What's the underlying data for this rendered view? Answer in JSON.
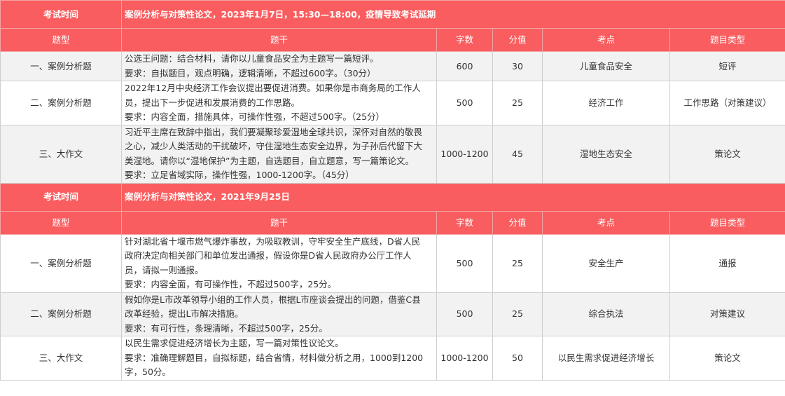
{
  "sections": [
    {
      "header_label": "考试时间",
      "header_value": "案例分析与对策性论文，2023年1月7日，15:30—18:00，疫情导致考试延期",
      "columns": [
        "题型",
        "题干",
        "字数",
        "分值",
        "考点",
        "题目类型"
      ],
      "rows": [
        {
          "type": "一、案例分析题",
          "lines": [
            "公选王问题：结合材料，请你以儿童食品安全为主题写一篇短评。",
            "要求：自拟题目，观点明确，逻辑清晰，不超过600字。（30分）"
          ],
          "words": "600",
          "score": "30",
          "point": "儿童食品安全",
          "category": "短评"
        },
        {
          "type": "二、案例分析题",
          "lines": [
            "2022年12月中央经济工作会议提出要促进消费。如果你是市商务局的工作人",
            "员，提出下一步促进和发展消费的工作思路。",
            "要求：内容全面，措施具体，可操作性强，不超过500字。（25分）"
          ],
          "words": "500",
          "score": "25",
          "point": "经济工作",
          "category": "工作思路（对策建议）"
        },
        {
          "type": "三、大作文",
          "lines": [
            "习近平主席在致辞中指出，我们要凝聚珍爱湿地全球共识，深怀对自然的敬畏",
            "之心，减少人类活动的干扰破坏，守住湿地生态安全边界，为子孙后代留下大",
            "美湿地。请你以“湿地保护”为主题，自选题目，自立题意，写一篇策论文。",
            "要求：立足省域实际，操作性强，1000-1200字。（45分）"
          ],
          "words": "1000-1200",
          "score": "45",
          "point": "湿地生态安全",
          "category": "策论文"
        }
      ]
    },
    {
      "header_label": "考试时间",
      "header_value": "案例分析与对策性论文，2021年9月25日",
      "columns": [
        "题型",
        "题干",
        "字数",
        "分值",
        "考点",
        "题目类型"
      ],
      "rows": [
        {
          "type": "一、案例分析题",
          "lines": [
            "针对湖北省十堰市燃气爆炸事故，为吸取教训，守牢安全生产底线，D省人民",
            "政府决定向相关部门和单位发出通报，假设你是D省人民政府办公厅工作人",
            "员，请拟一则通报。",
            "要求：内容全面，有可操作性，不超过500字，25分。"
          ],
          "words": "500",
          "score": "25",
          "point": "安全生产",
          "category": "通报"
        },
        {
          "type": "二、案例分析题",
          "lines": [
            "假如你是L市改革领导小组的工作人员，根据L市座谈会提出的问题，借鉴C县",
            "改革经验，提出L市解决措施。",
            "要求：有可行性，条理清晰，不超过500字，25分。"
          ],
          "words": "500",
          "score": "25",
          "point": "综合执法",
          "category": "对策建议"
        },
        {
          "type": "三、大作文",
          "lines": [
            "以民生需求促进经济增长为主题，写一篇对策性议论文。",
            "要求：准确理解题目，自拟标题，结合省情，材料做分析之用，1000到1200",
            "字，50分。"
          ],
          "words": "1000-1200",
          "score": "50",
          "point": "以民生需求促进经济增长",
          "category": "策论文"
        }
      ]
    }
  ]
}
